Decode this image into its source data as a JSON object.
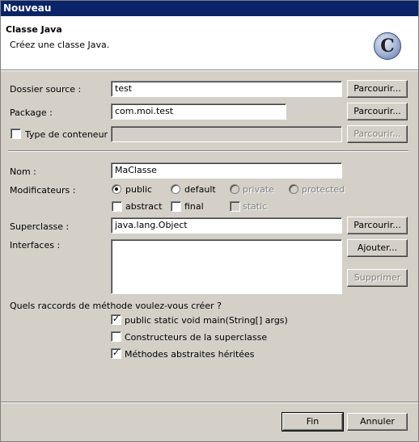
{
  "window": {
    "title": "Nouveau"
  },
  "banner": {
    "title": "Classe Java",
    "description": "Créez une classe Java.",
    "icon": "class-c-icon"
  },
  "form": {
    "source_folder_label": "Dossier source :",
    "source_folder_value": "test",
    "package_label": "Package :",
    "package_value": "com.moi.test",
    "container_type_label": "Type de conteneur :",
    "container_type_value": "",
    "name_label": "Nom :",
    "name_value": "MaClasse",
    "modifiers_label": "Modificateurs :",
    "modifiers": {
      "public": "public",
      "default": "default",
      "private": "private",
      "protected": "protected",
      "abstract": "abstract",
      "final": "final",
      "static": "static"
    },
    "superclass_label": "Superclasse :",
    "superclass_value": "java.lang.Object",
    "interfaces_label": "Interfaces :",
    "stubs_question": "Quels raccords de méthode voulez-vous créer ?",
    "stub_main": "public static void main(String[] args)",
    "stub_constructors": "Constructeurs de la superclasse",
    "stub_abstract": "Méthodes abstraites héritées"
  },
  "buttons": {
    "browse": "Parcourir...",
    "add": "Ajouter...",
    "remove": "Supprimer",
    "finish": "Fin",
    "cancel": "Annuler"
  },
  "colors": {
    "titlebar": "#0a246a",
    "dialog": "#d4d0c8",
    "banner": "#ffffff"
  }
}
